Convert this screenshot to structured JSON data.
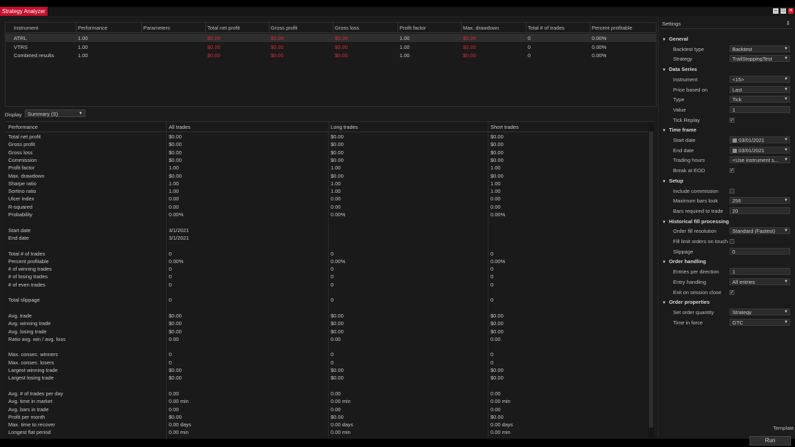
{
  "window": {
    "title": "Strategy Analyzer"
  },
  "instruments": {
    "headers": [
      "Instrument",
      "Performance",
      "Parameters",
      "Total net profit",
      "Gross profit",
      "Gross loss",
      "Profit factor",
      "Max. drawdown",
      "Total # of trades",
      "Percent profitable"
    ],
    "rows": [
      [
        "ATRL",
        "1.00",
        "",
        "$0.00",
        "$0.00",
        "$0.00",
        "1.00",
        "$0.00",
        "0",
        "0.00%"
      ],
      [
        "VTRS",
        "1.00",
        "",
        "$0.00",
        "$0.00",
        "$0.00",
        "1.00",
        "$0.00",
        "0",
        "0.00%"
      ],
      [
        "Combined results",
        "1.00",
        "",
        "$0.00",
        "$0.00",
        "$0.00",
        "1.00",
        "$0.00",
        "0",
        "0.00%"
      ]
    ]
  },
  "display": {
    "label": "Display",
    "value": "Summary (S)"
  },
  "performance": {
    "headers": [
      "Performance",
      "All trades",
      "Long trades",
      "Short trades"
    ],
    "rows": [
      [
        "Total net profit",
        "$0.00",
        "$0.00",
        "$0.00"
      ],
      [
        "Gross profit",
        "$0.00",
        "$0.00",
        "$0.00"
      ],
      [
        "Gross loss",
        "$0.00",
        "$0.00",
        "$0.00"
      ],
      [
        "Commission",
        "$0.00",
        "$0.00",
        "$0.00"
      ],
      [
        "Profit factor",
        "1.00",
        "1.00",
        "1.00"
      ],
      [
        "Max. drawdown",
        "$0.00",
        "$0.00",
        "$0.00"
      ],
      [
        "Sharpe ratio",
        "1.00",
        "1.00",
        "1.00"
      ],
      [
        "Sortino ratio",
        "1.00",
        "1.00",
        "1.00"
      ],
      [
        "Ulcer index",
        "0.00",
        "0.00",
        "0.00"
      ],
      [
        "R-squared",
        "0.00",
        "0.00",
        "0.00"
      ],
      [
        "Probability",
        "0.00%",
        "0.00%",
        "0.00%"
      ],
      [
        "",
        "",
        "",
        ""
      ],
      [
        "Start date",
        "3/1/2021",
        "",
        ""
      ],
      [
        "End date",
        "3/1/2021",
        "",
        ""
      ],
      [
        "",
        "",
        "",
        ""
      ],
      [
        "Total # of trades",
        "0",
        "0",
        "0"
      ],
      [
        "Percent profitable",
        "0.00%",
        "0.00%",
        "0.00%"
      ],
      [
        "# of winning trades",
        "0",
        "0",
        "0"
      ],
      [
        "# of losing trades",
        "0",
        "0",
        "0"
      ],
      [
        "# of even trades",
        "0",
        "0",
        "0"
      ],
      [
        "",
        "",
        "",
        ""
      ],
      [
        "Total slippage",
        "0",
        "0",
        "0"
      ],
      [
        "",
        "",
        "",
        ""
      ],
      [
        "Avg. trade",
        "$0.00",
        "$0.00",
        "$0.00"
      ],
      [
        "Avg. winning trade",
        "$0.00",
        "$0.00",
        "$0.00"
      ],
      [
        "Avg. losing trade",
        "$0.00",
        "$0.00",
        "$0.00"
      ],
      [
        "Ratio avg. win / avg. loss",
        "0.00",
        "0.00",
        "0.00"
      ],
      [
        "",
        "",
        "",
        ""
      ],
      [
        "Max. consec. winners",
        "0",
        "0",
        "0"
      ],
      [
        "Max. consec. losers",
        "0",
        "0",
        "0"
      ],
      [
        "Largest winning trade",
        "$0.00",
        "$0.00",
        "$0.00"
      ],
      [
        "Largest losing trade",
        "$0.00",
        "$0.00",
        "$0.00"
      ],
      [
        "",
        "",
        "",
        ""
      ],
      [
        "Avg. # of trades per day",
        "0.00",
        "0.00",
        "0.00"
      ],
      [
        "Avg. time in market",
        "0.00 min",
        "0.00 min",
        "0.00 min"
      ],
      [
        "Avg. bars in trade",
        "0.00",
        "0.00",
        "0.00"
      ],
      [
        "Profit per month",
        "$0.00",
        "$0.00",
        "$0.00"
      ],
      [
        "Max. time to recover",
        "0.00 days",
        "0.00 days",
        "0.00 days"
      ],
      [
        "Longest flat period",
        "0.00 min",
        "0.00 min",
        "0.00 min"
      ]
    ]
  },
  "settings": {
    "header": "Settings",
    "sections": [
      {
        "title": "General",
        "items": [
          {
            "label": "Backtest type",
            "value": "Backtest",
            "kind": "select"
          },
          {
            "label": "Strategy",
            "value": "TrailStoppingTest",
            "kind": "select"
          }
        ]
      },
      {
        "title": "Data Series",
        "items": [
          {
            "label": "Instrument",
            "value": "<15>",
            "kind": "select"
          },
          {
            "label": "Price based on",
            "value": "Last",
            "kind": "select"
          },
          {
            "label": "Type",
            "value": "Tick",
            "kind": "select"
          },
          {
            "label": "Value",
            "value": "1",
            "kind": "text"
          },
          {
            "label": "Tick Replay",
            "value": "✓",
            "kind": "check"
          }
        ]
      },
      {
        "title": "Time frame",
        "items": [
          {
            "label": "Start date",
            "value": "03/01/2021",
            "kind": "date"
          },
          {
            "label": "End date",
            "value": "03/01/2021",
            "kind": "date"
          },
          {
            "label": "Trading hours",
            "value": "<Use instrument s...",
            "kind": "select"
          },
          {
            "label": "Break at EOD",
            "value": "✓",
            "kind": "check"
          }
        ]
      },
      {
        "title": "Setup",
        "items": [
          {
            "label": "Include commission",
            "value": "",
            "kind": "check"
          },
          {
            "label": "Maximum bars look",
            "value": "256",
            "kind": "select"
          },
          {
            "label": "Bars required to trade",
            "value": "20",
            "kind": "text"
          }
        ]
      },
      {
        "title": "Historical fill processing",
        "items": [
          {
            "label": "Order fill resolution",
            "value": "Standard (Fastest)",
            "kind": "select"
          },
          {
            "label": "Fill limit orders on touch",
            "value": "",
            "kind": "check"
          },
          {
            "label": "Slippage",
            "value": "0",
            "kind": "text"
          }
        ]
      },
      {
        "title": "Order handling",
        "items": [
          {
            "label": "Entries per direction",
            "value": "1",
            "kind": "text"
          },
          {
            "label": "Entry handling",
            "value": "All entries",
            "kind": "select"
          },
          {
            "label": "Exit on session close",
            "value": "✓",
            "kind": "check"
          }
        ]
      },
      {
        "title": "Order properties",
        "items": [
          {
            "label": "Set order quantity",
            "value": "Strategy",
            "kind": "select"
          },
          {
            "label": "Time in force",
            "value": "GTC",
            "kind": "select"
          }
        ]
      }
    ],
    "template_label": "Template",
    "run_label": "Run"
  }
}
